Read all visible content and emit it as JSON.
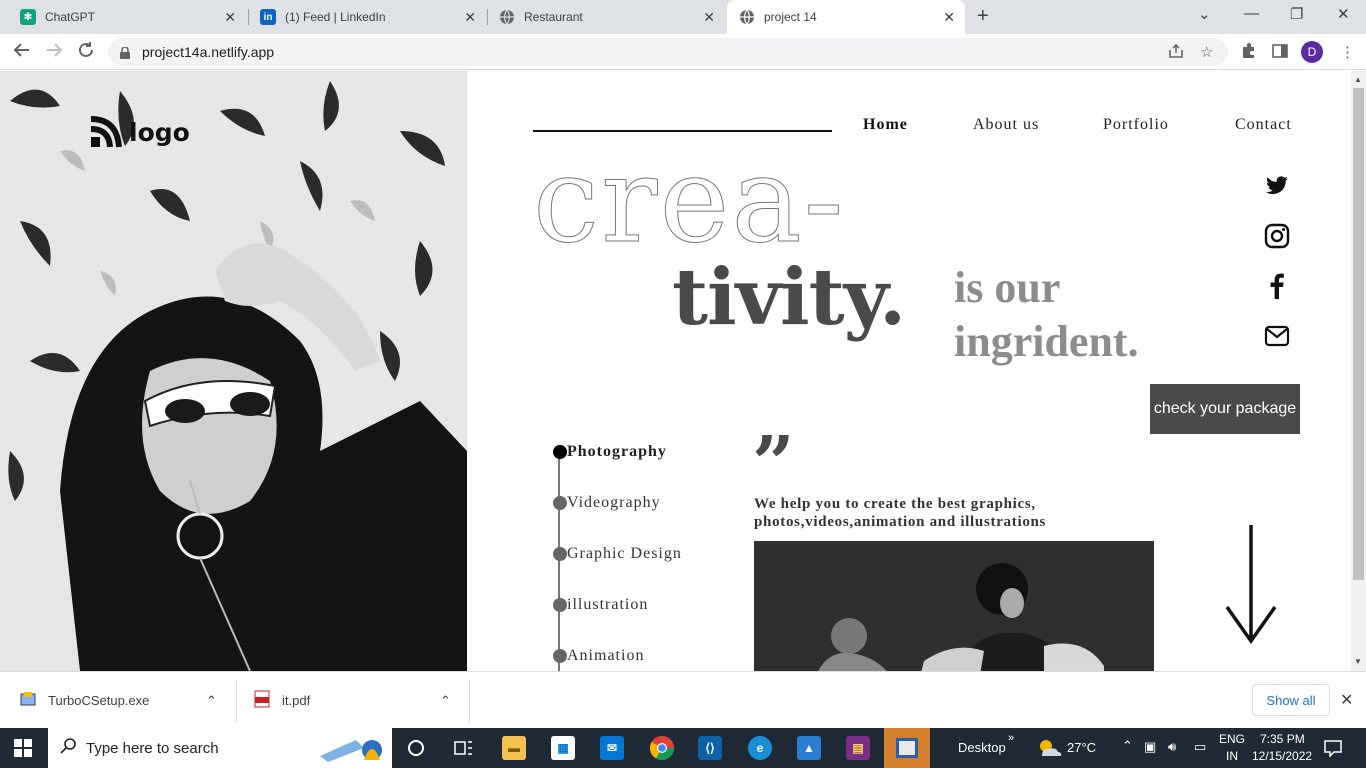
{
  "browser": {
    "tabs": [
      {
        "title": "ChatGPT",
        "favicon": "chatgpt-icon"
      },
      {
        "title": "(1) Feed | LinkedIn",
        "favicon": "linkedin-icon"
      },
      {
        "title": "Restaurant",
        "favicon": "globe-icon"
      },
      {
        "title": "project 14",
        "favicon": "globe-icon",
        "active": true
      }
    ],
    "url": "project14a.netlify.app",
    "profile_initial": "D"
  },
  "site": {
    "logo_text": "logo",
    "nav": [
      "Home",
      "About us",
      "Portfolio",
      "Contact"
    ],
    "active_nav": "Home",
    "headline_outline": "crea-",
    "headline_solid": "tivity.",
    "tagline_line1": "is our",
    "tagline_line2": "ingrident.",
    "social": [
      "twitter-icon",
      "instagram-icon",
      "facebook-icon",
      "mail-icon"
    ],
    "cta_label": "check your package",
    "services": [
      "Photography",
      "Videography",
      "Graphic Design",
      "illustration",
      "Animation"
    ],
    "active_service": "Photography",
    "quote_mark": "”",
    "quote_text": "We help you to create the best graphics, photos,videos,animation and illustrations"
  },
  "downloads": {
    "items": [
      {
        "name": "TurboCSetup.exe",
        "icon": "installer-icon"
      },
      {
        "name": "it.pdf",
        "icon": "pdf-icon"
      }
    ],
    "show_all": "Show all"
  },
  "taskbar": {
    "search_placeholder": "Type here to search",
    "desktop_label": "Desktop",
    "weather": "27°C",
    "lang_line1": "ENG",
    "lang_line2": "IN",
    "time": "7:35 PM",
    "date": "12/15/2022"
  }
}
